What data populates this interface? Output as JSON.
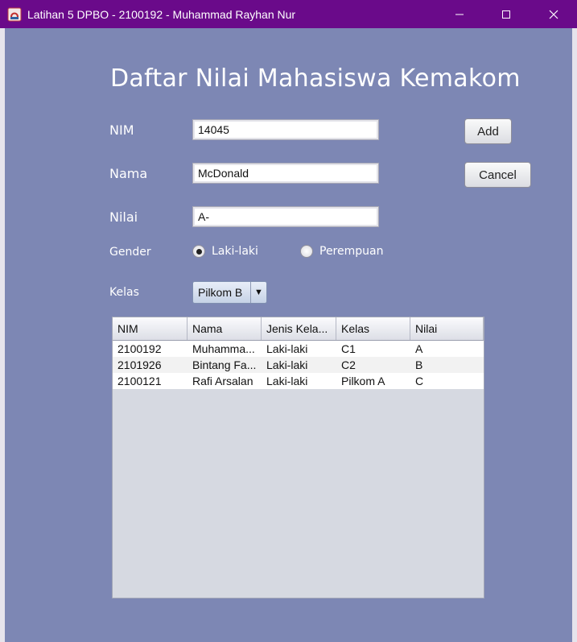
{
  "window": {
    "title": "Latihan 5 DPBO - 2100192 - Muhammad Rayhan Nur",
    "controls": {
      "minimize": "—",
      "maximize": "☐",
      "close": "✕"
    },
    "titlebar_color": "#6a0a8a"
  },
  "form": {
    "heading": "Daftar Nilai Mahasiswa Kemakom",
    "nim_label": "NIM",
    "nim_value": "14045",
    "nama_label": "Nama",
    "nama_value": "McDonald",
    "nilai_label": "Nilai",
    "nilai_value": "A-",
    "gender_label": "Gender",
    "gender_options": [
      "Laki-laki",
      "Perempuan"
    ],
    "gender_selected": "Laki-laki",
    "kelas_label": "Kelas",
    "kelas_selected": "Pilkom B",
    "add_label": "Add",
    "cancel_label": "Cancel",
    "background_color": "#7d87b4"
  },
  "table": {
    "columns": [
      "NIM",
      "Nama",
      "Jenis Kela...",
      "Kelas",
      "Nilai"
    ],
    "rows": [
      [
        "2100192",
        "Muhamma...",
        "Laki-laki",
        "C1",
        "A"
      ],
      [
        "2101926",
        "Bintang Fa...",
        "Laki-laki",
        "C2",
        "B"
      ],
      [
        "2100121",
        "Rafi Arsalan",
        "Laki-laki",
        "Pilkom A",
        "C"
      ]
    ]
  }
}
